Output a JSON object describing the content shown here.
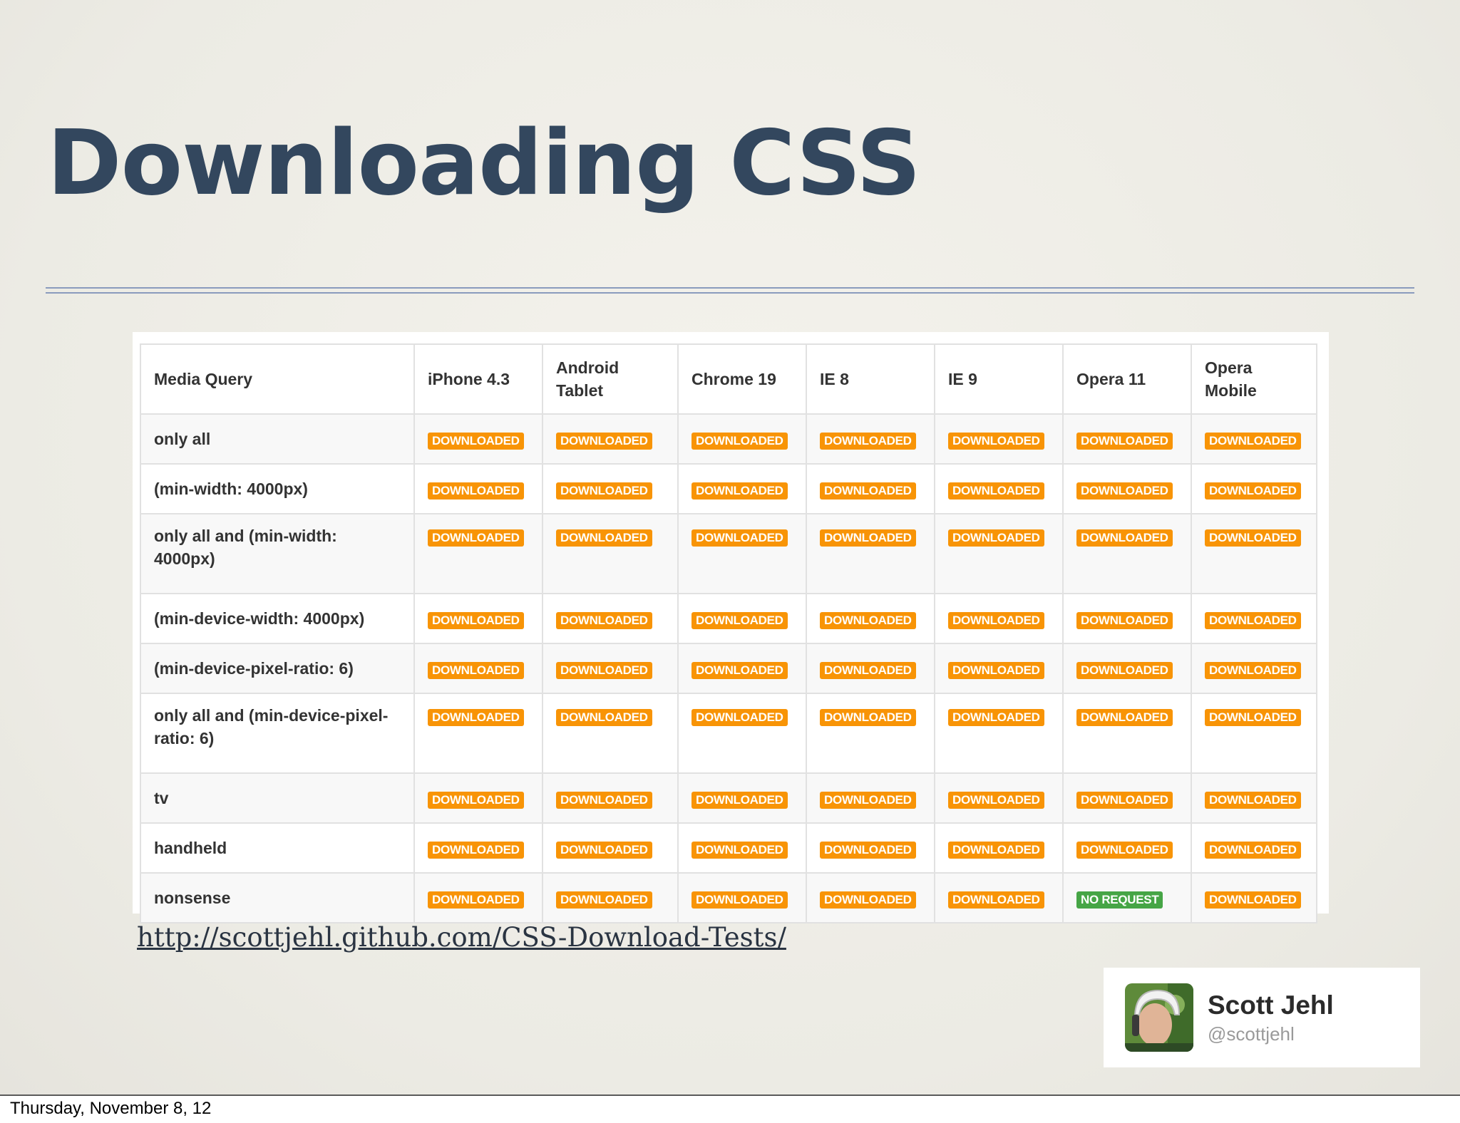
{
  "slide": {
    "title": "Downloading CSS",
    "link": "http://scottjehl.github.com/CSS-Download-Tests/",
    "footer_date": "Thursday, November 8, 12"
  },
  "table": {
    "headers": [
      "Media Query",
      "iPhone 4.3",
      "Android Tablet",
      "Chrome 19",
      "IE 8",
      "IE 9",
      "Opera 11",
      "Opera Mobile"
    ],
    "rows": [
      {
        "query": "only all",
        "results": [
          "DOWNLOADED",
          "DOWNLOADED",
          "DOWNLOADED",
          "DOWNLOADED",
          "DOWNLOADED",
          "DOWNLOADED",
          "DOWNLOADED"
        ]
      },
      {
        "query": "(min-width: 4000px)",
        "results": [
          "DOWNLOADED",
          "DOWNLOADED",
          "DOWNLOADED",
          "DOWNLOADED",
          "DOWNLOADED",
          "DOWNLOADED",
          "DOWNLOADED"
        ]
      },
      {
        "query": "only all and (min-width: 4000px)",
        "results": [
          "DOWNLOADED",
          "DOWNLOADED",
          "DOWNLOADED",
          "DOWNLOADED",
          "DOWNLOADED",
          "DOWNLOADED",
          "DOWNLOADED"
        ]
      },
      {
        "query": "(min-device-width: 4000px)",
        "results": [
          "DOWNLOADED",
          "DOWNLOADED",
          "DOWNLOADED",
          "DOWNLOADED",
          "DOWNLOADED",
          "DOWNLOADED",
          "DOWNLOADED"
        ]
      },
      {
        "query": "(min-device-pixel-ratio: 6)",
        "results": [
          "DOWNLOADED",
          "DOWNLOADED",
          "DOWNLOADED",
          "DOWNLOADED",
          "DOWNLOADED",
          "DOWNLOADED",
          "DOWNLOADED"
        ]
      },
      {
        "query": "only all and (min-device-pixel-ratio: 6)",
        "results": [
          "DOWNLOADED",
          "DOWNLOADED",
          "DOWNLOADED",
          "DOWNLOADED",
          "DOWNLOADED",
          "DOWNLOADED",
          "DOWNLOADED"
        ]
      },
      {
        "query": "tv",
        "results": [
          "DOWNLOADED",
          "DOWNLOADED",
          "DOWNLOADED",
          "DOWNLOADED",
          "DOWNLOADED",
          "DOWNLOADED",
          "DOWNLOADED"
        ]
      },
      {
        "query": "handheld",
        "results": [
          "DOWNLOADED",
          "DOWNLOADED",
          "DOWNLOADED",
          "DOWNLOADED",
          "DOWNLOADED",
          "DOWNLOADED",
          "DOWNLOADED"
        ]
      },
      {
        "query": "nonsense",
        "results": [
          "DOWNLOADED",
          "DOWNLOADED",
          "DOWNLOADED",
          "DOWNLOADED",
          "DOWNLOADED",
          "NO REQUEST",
          "DOWNLOADED"
        ]
      }
    ]
  },
  "profile": {
    "name": "Scott Jehl",
    "handle": "@scottjehl",
    "avatar_icon": "user-avatar-photo"
  },
  "colors": {
    "title": "#33475e",
    "downloaded_badge": "#f89406",
    "no_request_badge": "#46a546",
    "rule": "#8a9bbd"
  }
}
